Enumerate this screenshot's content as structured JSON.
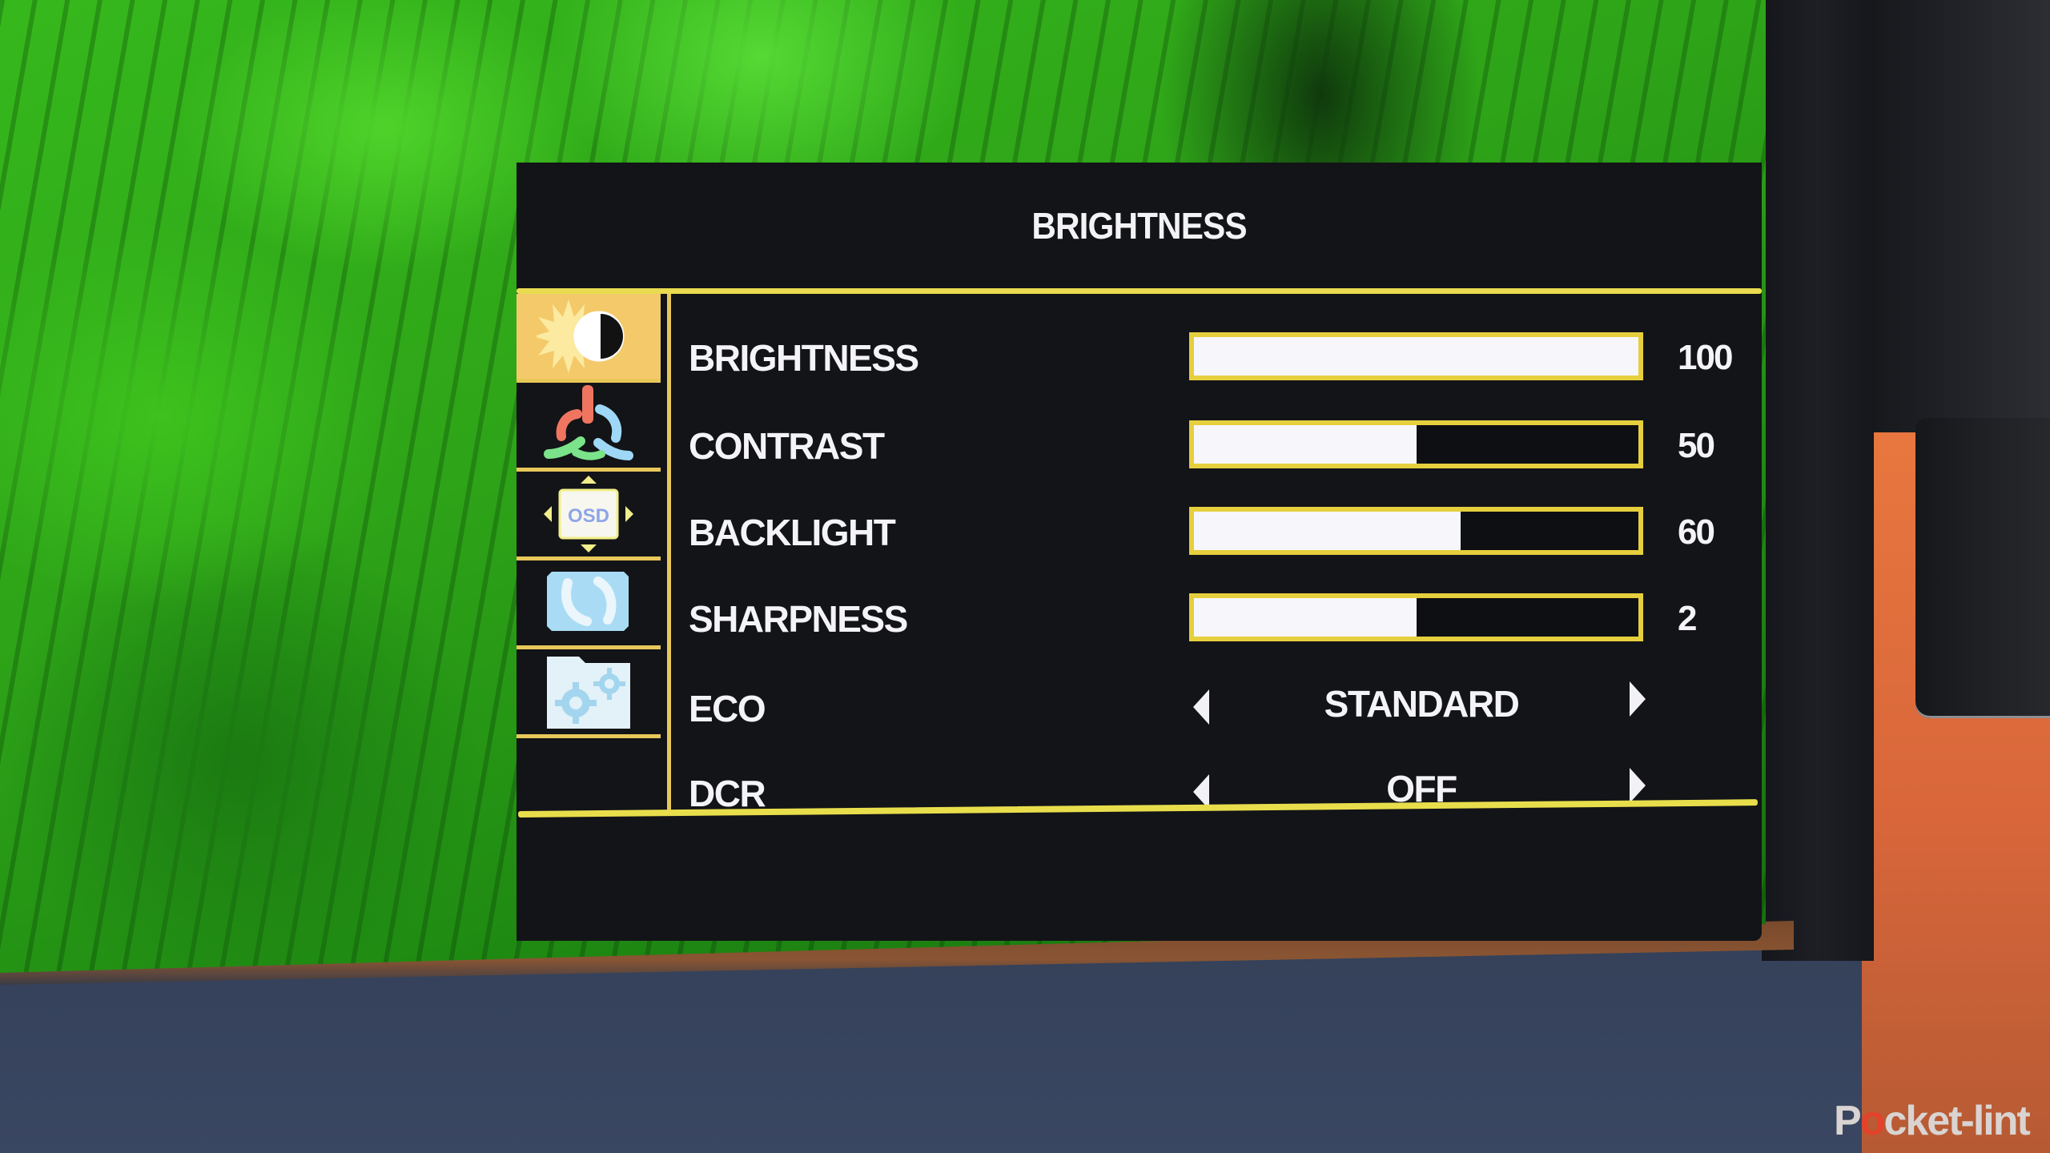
{
  "osd": {
    "title": "BRIGHTNESS",
    "sidebar": [
      {
        "name": "brightness-contrast",
        "icon": "sun-half-moon-icon",
        "active": true
      },
      {
        "name": "color",
        "icon": "rgb-color-icon",
        "active": false
      },
      {
        "name": "osd-settings",
        "icon": "osd-position-icon",
        "active": false
      },
      {
        "name": "reset",
        "icon": "reset-arrows-icon",
        "active": false
      },
      {
        "name": "setup",
        "icon": "folder-gears-icon",
        "active": false
      }
    ],
    "rows": [
      {
        "label": "BRIGHTNESS",
        "type": "slider",
        "value": "100",
        "fraction": 1.0
      },
      {
        "label": "CONTRAST",
        "type": "slider",
        "value": "50",
        "fraction": 0.5
      },
      {
        "label": "BACKLIGHT",
        "type": "slider",
        "value": "60",
        "fraction": 0.6
      },
      {
        "label": "SHARPNESS",
        "type": "slider",
        "value": "2",
        "fraction": 0.5
      },
      {
        "label": "ECO",
        "type": "option",
        "value": "STANDARD"
      },
      {
        "label": "DCR",
        "type": "option",
        "value": "OFF"
      }
    ],
    "colors": {
      "accent": "#e9db4f",
      "active_tab": "#f4c96a",
      "panel": "#131417",
      "text": "#f4f4f8"
    }
  },
  "watermark": {
    "prefix": "P",
    "o": "o",
    "suffix": "cket-lint"
  }
}
